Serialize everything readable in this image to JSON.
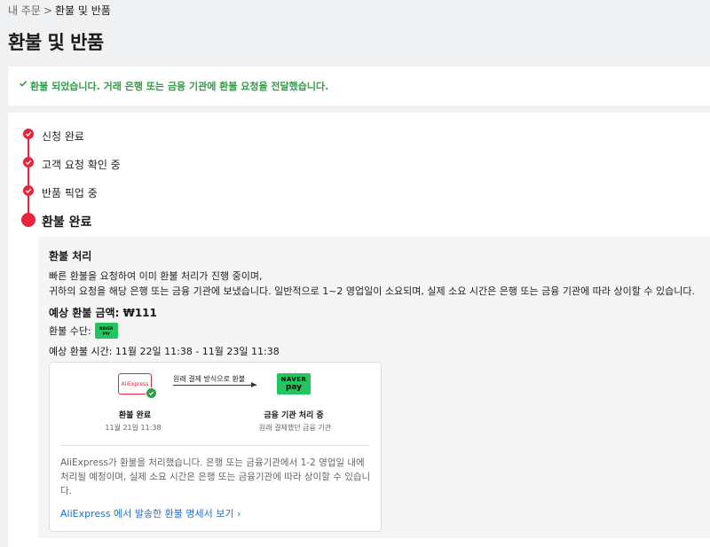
{
  "breadcrumb": {
    "parent": "내 주문",
    "separator": ">",
    "current": "환불 및 반품"
  },
  "page": {
    "title": "환불 및 반품"
  },
  "alert": {
    "message": "환불 되었습니다. 거래 은행 또는 금융 기관에 환불 요청을 전달했습니다.",
    "icon": "check-icon",
    "color": "#2e9e46"
  },
  "timeline": {
    "steps": [
      {
        "label": "신청 완료",
        "done": true
      },
      {
        "label": "고객 요청 확인 중",
        "done": true
      },
      {
        "label": "반품 픽업 중",
        "done": true
      },
      {
        "label": "환불 완료",
        "current": true
      }
    ],
    "accent": "#e8243c"
  },
  "detail": {
    "title": "환불 처리",
    "description_line1": "빠른 환불을 요청하여 이미 환불 처리가 진행 중이며,",
    "description_line2": "귀하의 요청을 해당 은행 또는 금융 기관에 보냈습니다. 일반적으로 1~2 영업일이 소요되며, 실제 소요 시간은 은행 또는 금융 기관에 따라 상이할 수 있습니다.",
    "amount_label": "예상 환불 금액:",
    "amount_value": "₩111",
    "method_label": "환불 수단:",
    "expected_time": "예상 환불 시간: 11월 22일 11:38 - 11월 23일 11:38"
  },
  "flow": {
    "source_logo": "AliExpress",
    "arrow_label": "원래 결제 방식으로 환불",
    "target_logo_line1": "NAVER",
    "target_logo_line2": "pay",
    "mini_logo_line1": "NAVER",
    "mini_logo_line2": "pay",
    "source_status": "환불 완료",
    "source_date": "11월 21일 11:38",
    "target_status": "금융 기관 처리 중",
    "target_sub": "원래 결제했던 금융 기관",
    "note": "AliExpress가 환불을 처리했습니다. 은행 또는 금융기관에서 1-2 영업일 내에 처리될 예정이며, 실제 소요 시간은 은행 또는 금융기관에 따라 상이할 수 있습니다.",
    "link": "AliExpress 에서 발송한 환불 명세서 보기 ›",
    "link_color": "#1f6fd6",
    "naver_green": "#22c55e"
  }
}
